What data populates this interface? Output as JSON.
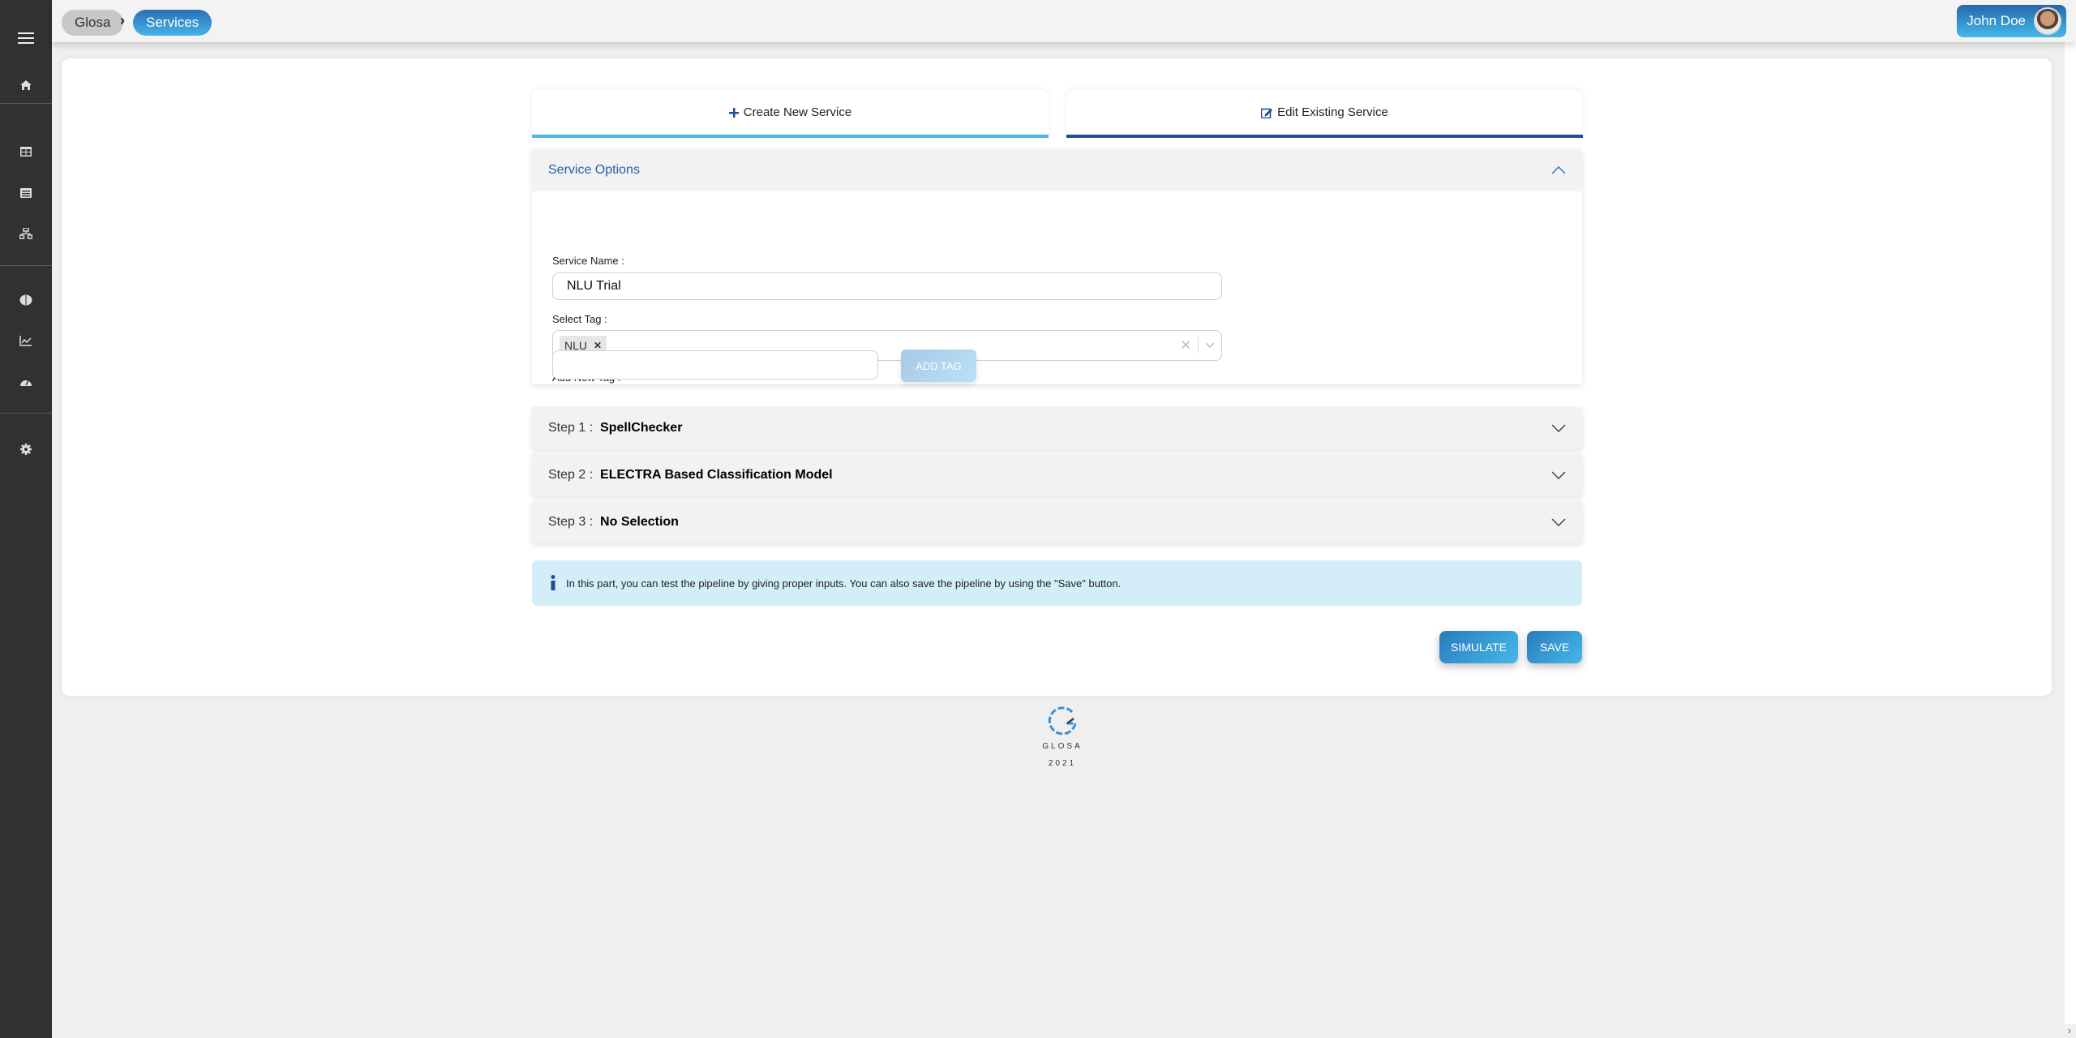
{
  "sidebar": {
    "items": [
      {
        "icon": "menu-icon"
      },
      {
        "icon": "home-icon"
      },
      {
        "icon": "table-icon"
      },
      {
        "icon": "list-icon"
      },
      {
        "icon": "sitemap-icon"
      },
      {
        "icon": "brain-icon"
      },
      {
        "icon": "chart-line-icon"
      },
      {
        "icon": "dashboard-icon"
      },
      {
        "icon": "gear-icon"
      }
    ]
  },
  "header": {
    "breadcrumb": [
      "Glosa",
      "Services"
    ],
    "user_name": "John Doe"
  },
  "tabs": {
    "create": "Create New Service",
    "edit": "Edit Existing Service"
  },
  "service_options": {
    "title": "Service Options",
    "service_name_label": "Service Name :",
    "service_name_value": "NLU Trial",
    "select_tag_label": "Select Tag :",
    "selected_tags": [
      "NLU"
    ],
    "add_new_tag_label": "Add New Tag :",
    "add_new_tag_value": "",
    "add_tag_button": "ADD TAG"
  },
  "steps": [
    {
      "prefix": "Step 1 :",
      "name": "SpellChecker"
    },
    {
      "prefix": "Step 2 :",
      "name": "ELECTRA Based Classification Model"
    },
    {
      "prefix": "Step 3 :",
      "name": "No Selection"
    }
  ],
  "info": {
    "text": "In this part, you can test the pipeline by giving proper inputs. You can also save the pipeline by using the \"Save\" button."
  },
  "actions": {
    "simulate": "SIMULATE",
    "save": "SAVE"
  },
  "footer": {
    "brand": "GLOSA",
    "year": "2021"
  },
  "colors": {
    "accent_light": "#4ab7e8",
    "accent_dark": "#1f4f93",
    "sidebar_bg": "#313131",
    "info_bg": "#d4eef9"
  }
}
